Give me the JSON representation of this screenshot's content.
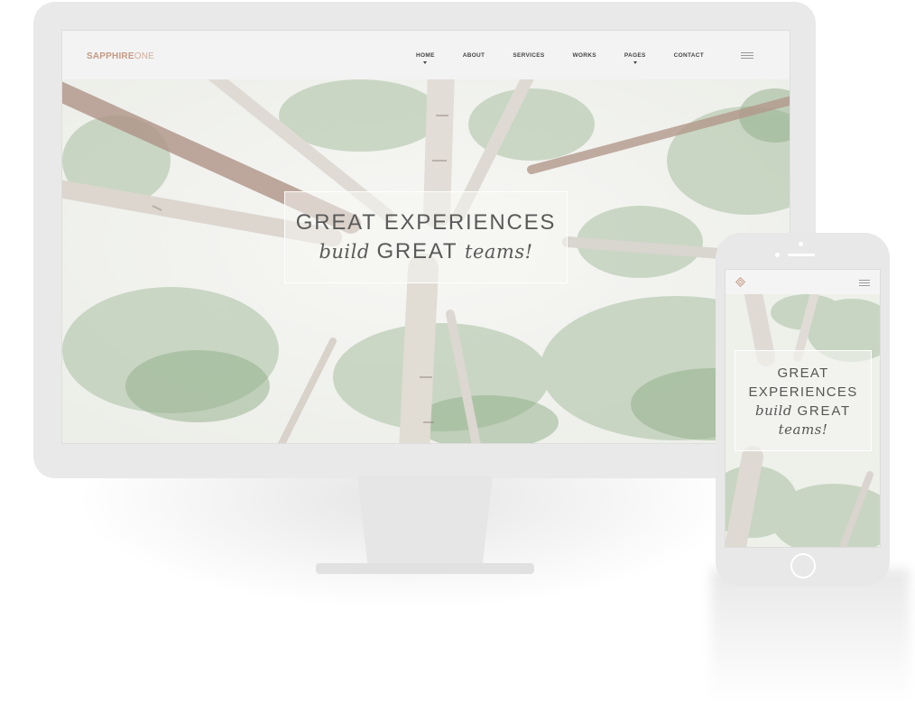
{
  "desktop": {
    "logo": {
      "bold": "SAPPHIRE",
      "light": "ONE"
    },
    "nav": [
      {
        "label": "HOME",
        "dropdown": true
      },
      {
        "label": "ABOUT",
        "dropdown": false
      },
      {
        "label": "SERVICES",
        "dropdown": false
      },
      {
        "label": "WORKS",
        "dropdown": false
      },
      {
        "label": "PAGES",
        "dropdown": true
      },
      {
        "label": "CONTACT",
        "dropdown": false
      }
    ],
    "hero": {
      "line1": "GREAT EXPERIENCES",
      "line2_italic": "build",
      "line2_caps": "GREAT",
      "line2_italic_end": "teams!"
    }
  },
  "mobile": {
    "hero": {
      "line1": "GREAT",
      "line2": "EXPERIENCES",
      "line3_italic": "build",
      "line3_caps": "GREAT",
      "line4_italic": "teams!"
    }
  },
  "colors": {
    "accent": "#c49a85",
    "text_dark": "#5a5a5a",
    "device_frame": "#e9e9e9"
  },
  "icons": [
    "hamburger-menu-icon",
    "diamond-logo-icon",
    "caret-down-icon"
  ]
}
